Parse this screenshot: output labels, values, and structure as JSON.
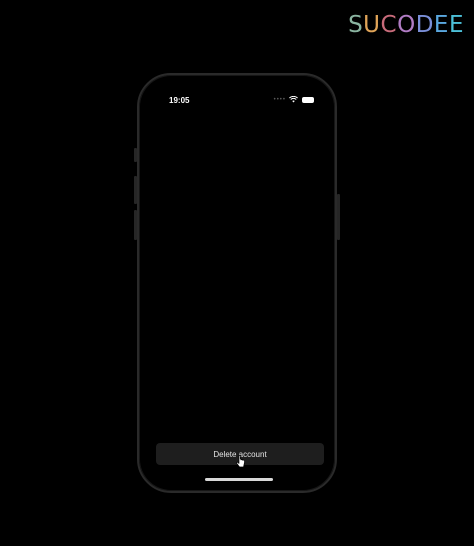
{
  "brand": {
    "letters": [
      {
        "char": "S",
        "color": "#8ab4a0"
      },
      {
        "char": "U",
        "color": "#e0a458"
      },
      {
        "char": "C",
        "color": "#c86b7a"
      },
      {
        "char": "O",
        "color": "#b17cc4"
      },
      {
        "char": "D",
        "color": "#7a8fd8"
      },
      {
        "char": "E",
        "color": "#5aa8e0"
      },
      {
        "char": "E",
        "color": "#4cc0d8"
      }
    ]
  },
  "status_bar": {
    "time": "19:05",
    "dots": "••••"
  },
  "actions": {
    "delete_account_label": "Delete account"
  },
  "colors": {
    "background": "#000000",
    "button_bg": "#1e1e1e",
    "button_text": "#e6e6e6"
  }
}
